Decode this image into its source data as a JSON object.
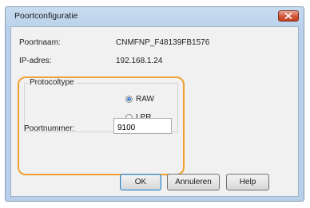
{
  "window": {
    "title": "Poortconfiguratie"
  },
  "fields": {
    "port_name_label": "Poortnaam:",
    "port_name_value": "CNMFNP_F48139FB1576",
    "ip_label": "IP-adres:",
    "ip_value": "192.168.1.24"
  },
  "protocol": {
    "legend": "Protocoltype",
    "options": [
      {
        "label": "RAW",
        "selected": true
      },
      {
        "label": "LPR",
        "selected": false
      }
    ]
  },
  "port_number": {
    "label": "Poortnummer:",
    "value": "9100"
  },
  "buttons": {
    "ok": "OK",
    "cancel": "Annuleren",
    "help": "Help"
  },
  "colors": {
    "highlight": "#f0a030",
    "titlebar": "#b8d0ea",
    "close_button": "#c2401f"
  },
  "icons": {
    "close": "close-x-icon"
  }
}
